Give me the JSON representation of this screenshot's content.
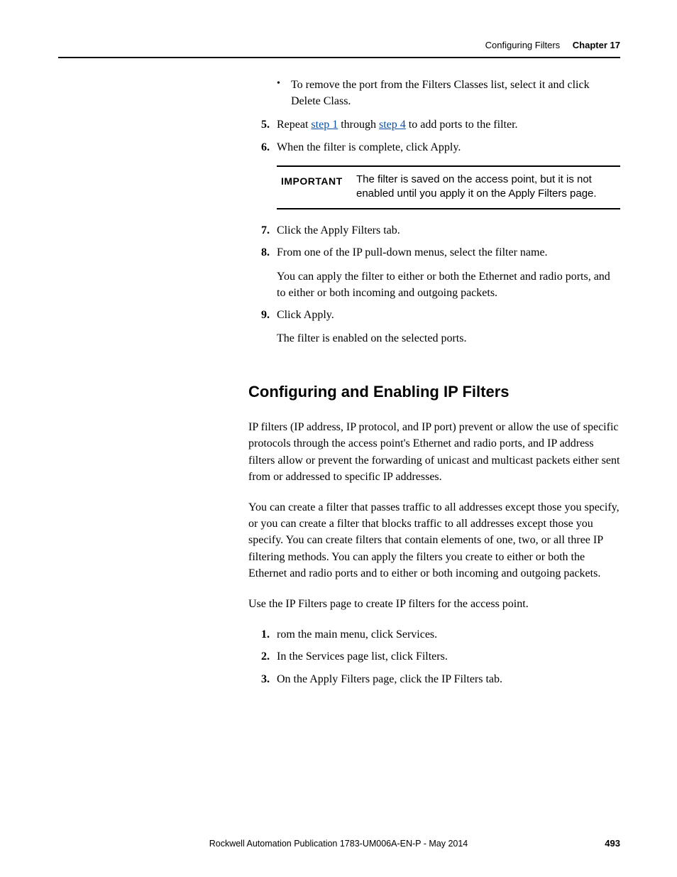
{
  "header": {
    "section": "Configuring Filters",
    "chapter": "Chapter 17"
  },
  "bullet": {
    "text": "To remove the port from the Filters Classes list, select it and click Delete Class."
  },
  "steps_a": {
    "5": {
      "pre": "Repeat ",
      "link1": "step 1",
      "mid": " through ",
      "link2": "step 4",
      "post": " to add ports to the filter."
    },
    "6": "When the filter is complete, click Apply."
  },
  "callout": {
    "label": "IMPORTANT",
    "msg": "The filter is saved on the access point, but it is not enabled until you apply it on the Apply Filters page."
  },
  "steps_b": {
    "7": "Click the Apply Filters tab.",
    "8": "From one of the IP pull-down menus, select the filter name.",
    "8_cont": "You can apply the filter to either or both the Ethernet and radio ports, and to either or both incoming and outgoing packets.",
    "9": "Click Apply.",
    "9_cont": "The filter is enabled on the selected ports."
  },
  "section": {
    "title": "Configuring and Enabling IP Filters",
    "p1": "IP filters (IP address, IP protocol, and IP port) prevent or allow the use of specific protocols through the access point's Ethernet and radio ports, and IP address filters allow or prevent the forwarding of unicast and multicast packets either sent from or addressed to specific IP addresses.",
    "p2": "You can create a filter that passes traffic to all addresses except those you specify, or you can create a filter that blocks traffic to all addresses except those you specify. You can create filters that contain elements of one, two, or all three IP filtering methods. You can apply the filters you create to either or both the Ethernet and radio ports and to either or both incoming and outgoing packets.",
    "p3": "Use the IP Filters page to create IP filters for the access point."
  },
  "steps_c": {
    "1": "rom the main menu, click Services.",
    "2": "In the Services page list, click Filters.",
    "3": "On the Apply Filters page, click the IP Filters tab."
  },
  "footer": {
    "pub": "Rockwell Automation Publication 1783-UM006A-EN-P - May 2014",
    "page": "493"
  }
}
